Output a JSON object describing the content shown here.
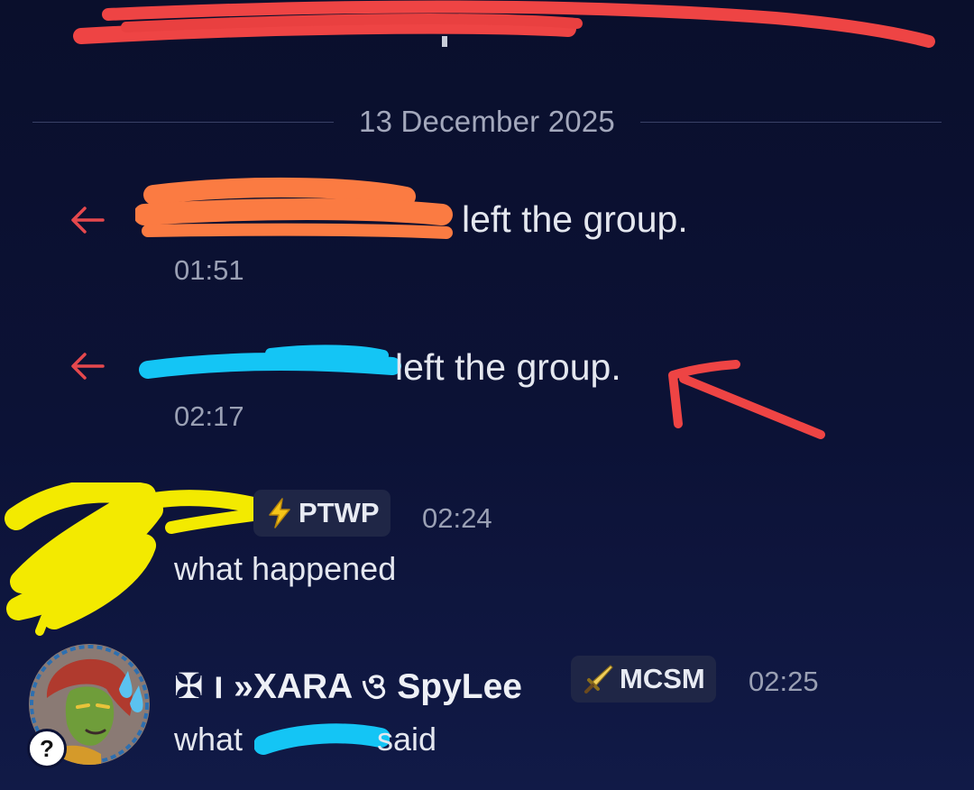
{
  "divider": {
    "date": "13 December 2025"
  },
  "system_messages": [
    {
      "text": "left the group.",
      "time": "01:51"
    },
    {
      "text": "left the group.",
      "time": "02:17"
    }
  ],
  "messages": [
    {
      "username": "",
      "tag": "PTWP",
      "tag_icon": "lightning-icon",
      "time": "02:24",
      "text": "what happened"
    },
    {
      "username": "✠ ו »XARA ও SpyLee",
      "tag": "MCSM",
      "tag_icon": "sword-icon",
      "time": "02:25",
      "text_before": "what",
      "text_after": "said",
      "avatar_badge": "?"
    }
  ],
  "colors": {
    "background": "#0c1236",
    "system_arrow": "#e5484d",
    "text_primary": "#e4e7ef",
    "text_muted": "#9aa0b4",
    "tag_background": "#1f2646"
  }
}
